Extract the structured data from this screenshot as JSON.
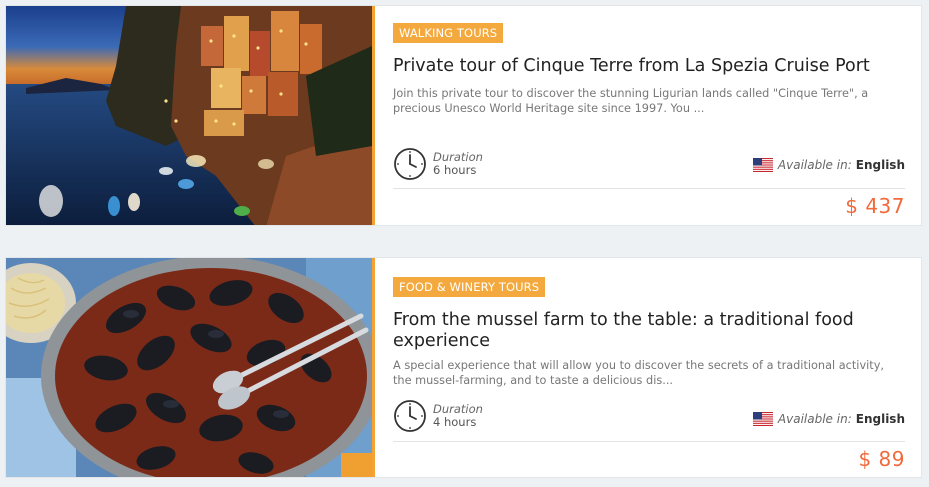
{
  "tours": [
    {
      "category": "WALKING TOURS",
      "title": "Private tour of Cinque Terre from La Spezia Cruise Port",
      "description": "Join this private tour to discover the stunning Ligurian lands called \"Cinque Terre\", a precious Unesco World Heritage site since 1997. You ...",
      "duration_label": "Duration",
      "duration_value": "6 hours",
      "available_label": "Available in:",
      "language": "English",
      "price": "$ 437",
      "image_icon": "cinque-terre-photo"
    },
    {
      "category": "FOOD & WINERY TOURS",
      "title": "From the mussel farm to the table: a traditional food experience",
      "description": "A special experience that will allow you to discover the secrets of a traditional activity, the mussel-farming, and to taste a delicious dis...",
      "duration_label": "Duration",
      "duration_value": "4 hours",
      "available_label": "Available in:",
      "language": "English",
      "price": "$ 89",
      "image_icon": "mussels-pan-photo"
    }
  ],
  "colors": {
    "accent": "#f4a93f",
    "price": "#f26a3c"
  }
}
